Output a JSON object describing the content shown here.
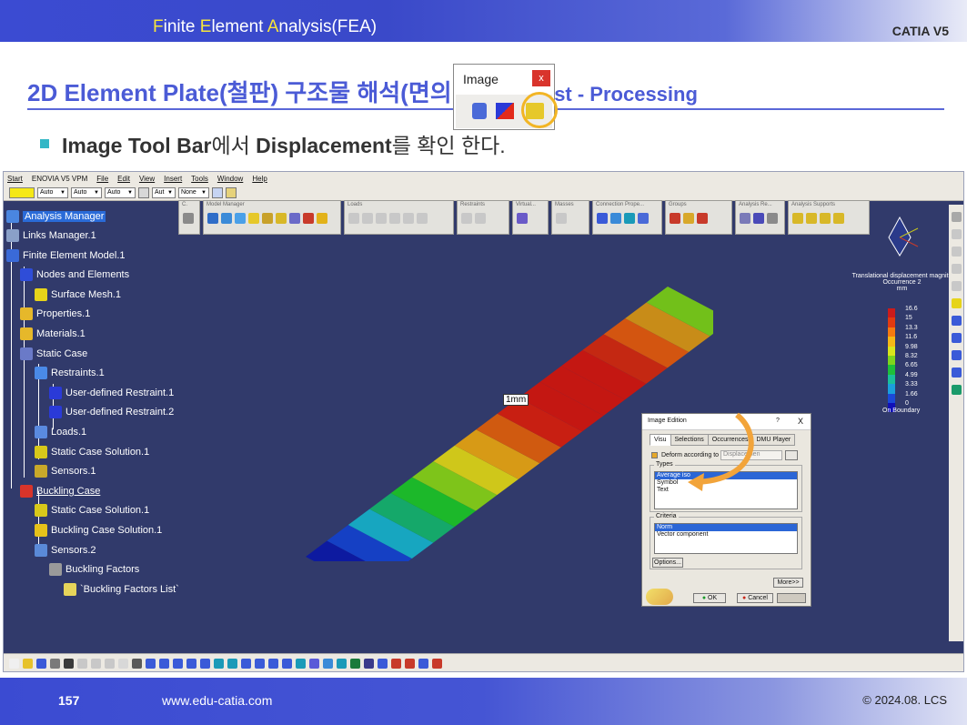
{
  "slide": {
    "header_title_parts": [
      "F",
      "inite ",
      "E",
      "lement ",
      "A",
      "nalysis(FEA)"
    ],
    "brand": "CATIA V5",
    "title_main": "2D Element Plate(철판) 구조물 해석(면의 좌굴)",
    "title_sub": ": Post - Processing",
    "bullet_parts": [
      "Image Tool Bar",
      "에서 ",
      "Displacement",
      "를 확인 한다."
    ],
    "page_number": "157",
    "url": "www.edu-catia.com",
    "copyright": "© 2024.08. LCS"
  },
  "catia": {
    "menu": [
      "Start",
      "ENOVIA V5 VPM",
      "File",
      "Edit",
      "View",
      "Insert",
      "Tools",
      "Window",
      "Help"
    ],
    "combos": [
      "Auto",
      "Auto",
      "Auto",
      "Aut",
      "None"
    ],
    "toolbars": [
      "C.",
      "Model Manager",
      "Loads",
      "Restraints",
      "Virtual...",
      "Masses",
      "Connection Prope...",
      "Groups",
      "Analysis Re...",
      "Analysis Supports"
    ],
    "tree": {
      "root": "Analysis Manager",
      "links": "Links Manager.1",
      "fem": "Finite Element Model.1",
      "nodes": "Nodes and Elements",
      "mesh": "Surface Mesh.1",
      "properties": "Properties.1",
      "materials": "Materials.1",
      "static_case": "Static Case",
      "restraints": "Restraints.1",
      "restraint1": "User-defined Restraint.1",
      "restraint2": "User-defined Restraint.2",
      "loads": "Loads.1",
      "static_solution": "Static Case Solution.1",
      "sensors1": "Sensors.1",
      "buckling_case": "Buckling Case",
      "static_solution2": "Static Case Solution.1",
      "buckling_solution": "Buckling Case Solution.1",
      "sensors2": "Sensors.2",
      "buckling_factors": "Buckling Factors",
      "buckling_list": "`Buckling Factors List`"
    },
    "image_toolbar": {
      "title": "Image",
      "close": "x"
    },
    "legend": {
      "title": "Translational displacement magnitu",
      "occurrence": "Occurrence 2",
      "unit": "mm",
      "values": [
        "16.6",
        "15",
        "13.3",
        "11.6",
        "9.98",
        "8.32",
        "6.65",
        "4.99",
        "3.33",
        "1.66",
        "0"
      ],
      "colors": [
        "#cc1b1b",
        "#e23a10",
        "#f57a10",
        "#f5b816",
        "#d9e51c",
        "#7fd41d",
        "#1fbf3a",
        "#1bbf9a",
        "#1b9fdc",
        "#1b49d8",
        "#1010b8"
      ],
      "footer": "On Boundary"
    },
    "scale_label": "1mm",
    "plate_colors": [
      "#0d1aa0",
      "#1540c4",
      "#17a6c0",
      "#15a86a",
      "#1cb82a",
      "#7ec41a",
      "#cfc71a",
      "#d79a16",
      "#d05a10",
      "#c81f12",
      "#c41712",
      "#c41712",
      "#c41712",
      "#c42812",
      "#d35510",
      "#c88c18",
      "#72c01a"
    ],
    "dialog": {
      "title": "Image Edition",
      "help": "?",
      "close": "X",
      "tabs": [
        "Visu",
        "Selections",
        "Occurrences",
        "DMU Player"
      ],
      "deform_label": "Deform according to",
      "deform_value": "Displacemen",
      "types_label": "Types",
      "types": [
        "Average iso",
        "Symbol",
        "Text"
      ],
      "criteria_label": "Criteria",
      "criteria": [
        "Norm",
        "Vector component"
      ],
      "options": "Options...",
      "more": "More>>",
      "ok": "OK",
      "cancel": "Cancel"
    }
  }
}
